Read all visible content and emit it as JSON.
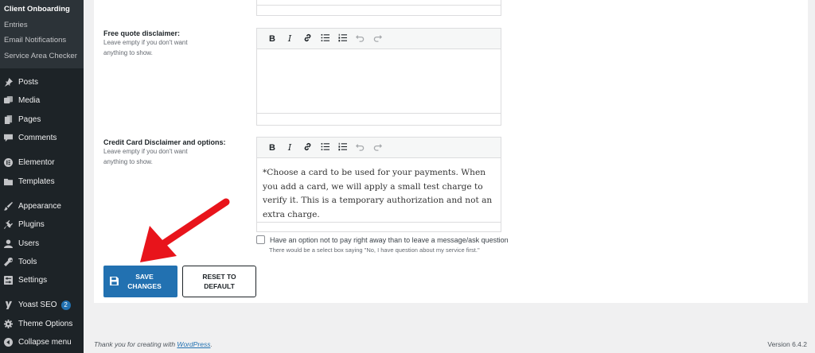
{
  "sidebar": {
    "submenu": [
      "Client Onboarding",
      "Entries",
      "Email Notifications",
      "Service Area Checker"
    ],
    "menu": [
      {
        "label": "Posts",
        "icon": "pin-icon"
      },
      {
        "label": "Media",
        "icon": "media-icon"
      },
      {
        "label": "Pages",
        "icon": "pages-icon"
      },
      {
        "label": "Comments",
        "icon": "comments-icon"
      },
      {
        "label": "Elementor",
        "icon": "elementor-icon"
      },
      {
        "label": "Templates",
        "icon": "folder-icon"
      },
      {
        "label": "Appearance",
        "icon": "brush-icon"
      },
      {
        "label": "Plugins",
        "icon": "plugin-icon"
      },
      {
        "label": "Users",
        "icon": "user-icon"
      },
      {
        "label": "Tools",
        "icon": "wrench-icon"
      },
      {
        "label": "Settings",
        "icon": "settings-icon"
      },
      {
        "label": "Yoast SEO",
        "icon": "yoast-icon",
        "badge": "2"
      },
      {
        "label": "Theme Options",
        "icon": "gear-icon"
      },
      {
        "label": "Collapse menu",
        "icon": "collapse-icon"
      }
    ]
  },
  "fields": {
    "free_quote": {
      "label": "Free quote disclaimer:",
      "help": "Leave empty if you don't want anything to show."
    },
    "credit_card": {
      "label": "Credit Card Disclaimer and options:",
      "help": "Leave empty if you don't want anything to show.",
      "content": "*Choose a card to be used for your payments. When you add a card, we will apply a small test charge to verify it. This is a temporary authorization and not an extra charge."
    }
  },
  "toolbar": {
    "bold": "B",
    "italic": "I"
  },
  "option": {
    "label": "Have an option not to pay right away than to leave a message/ask question",
    "help": "There would be a select box saying \"No, I have question about my service first.\""
  },
  "buttons": {
    "save_line1": "SAVE",
    "save_line2": "CHANGES",
    "reset_line1": "RESET TO",
    "reset_line2": "DEFAULT"
  },
  "footer": {
    "thanks_prefix": "Thank you for creating with ",
    "thanks_link": "WordPress",
    "thanks_suffix": ".",
    "version": "Version 6.4.2"
  },
  "colors": {
    "sidebar": "#1d2327",
    "primary": "#2271b1",
    "arrow": "#e8141b"
  }
}
